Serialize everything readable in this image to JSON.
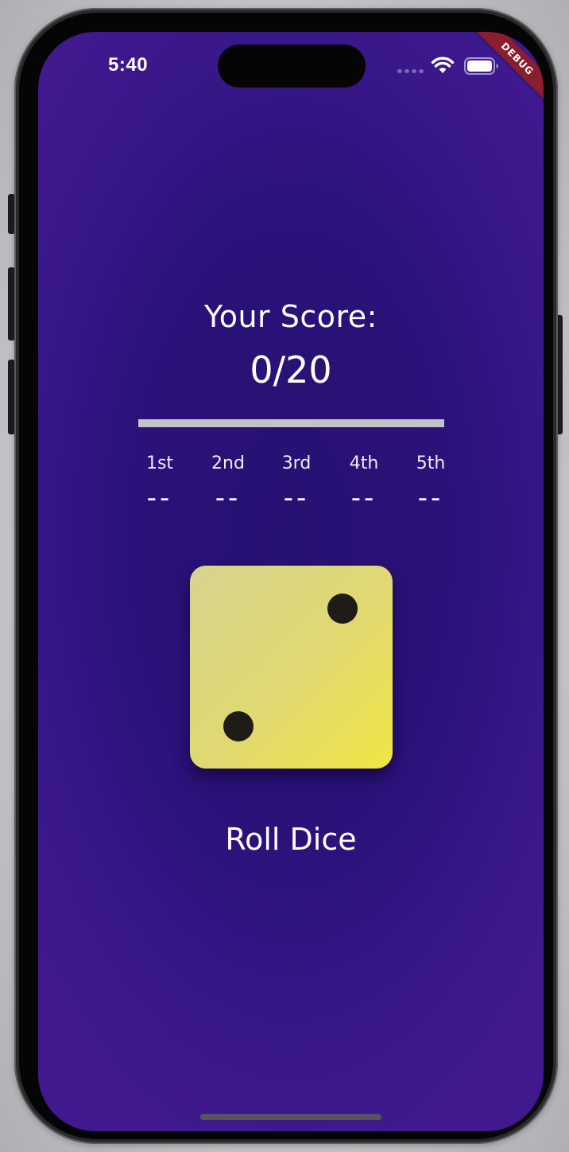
{
  "status_bar": {
    "time": "5:40",
    "icons": [
      "cellular-signal-icon",
      "wifi-icon",
      "battery-icon"
    ],
    "debug_banner": "DEBUG"
  },
  "score": {
    "label": "Your Score:",
    "value": "0/20",
    "progress_fraction": 0.0
  },
  "rounds": [
    {
      "label": "1st",
      "value": "--"
    },
    {
      "label": "2nd",
      "value": "--"
    },
    {
      "label": "3rd",
      "value": "--"
    },
    {
      "label": "4th",
      "value": "--"
    },
    {
      "label": "5th",
      "value": "--"
    }
  ],
  "dice": {
    "face_value": 2,
    "icon": "dice-two-icon"
  },
  "roll_button": {
    "label": "Roll Dice"
  },
  "colors": {
    "background": "#2b1179",
    "dice_face": "#e4dc62",
    "pip": "#1f1c17",
    "progress_track": "#c4c3c8",
    "debug_ribbon": "#8a1d2e",
    "text": "#ffffff"
  }
}
